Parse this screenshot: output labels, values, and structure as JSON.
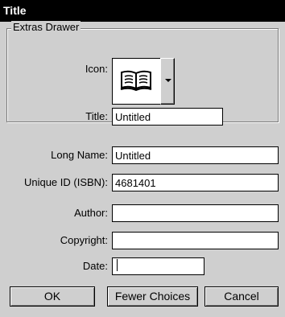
{
  "window": {
    "title": "Title"
  },
  "extras": {
    "group_label": "Extras Drawer",
    "icon_label": "Icon:",
    "icon": "open-book-icon",
    "title_label": "Title:",
    "title_value": "Untitled"
  },
  "fields": {
    "long_name_label": "Long Name:",
    "long_name_value": "Untitled",
    "unique_id_label": "Unique ID (ISBN):",
    "unique_id_value": "4681401",
    "author_label": "Author:",
    "author_value": "",
    "copyright_label": "Copyright:",
    "copyright_value": "",
    "date_label": "Date:",
    "date_value": ""
  },
  "buttons": {
    "ok": "OK",
    "fewer_choices": "Fewer Choices",
    "cancel": "Cancel"
  }
}
